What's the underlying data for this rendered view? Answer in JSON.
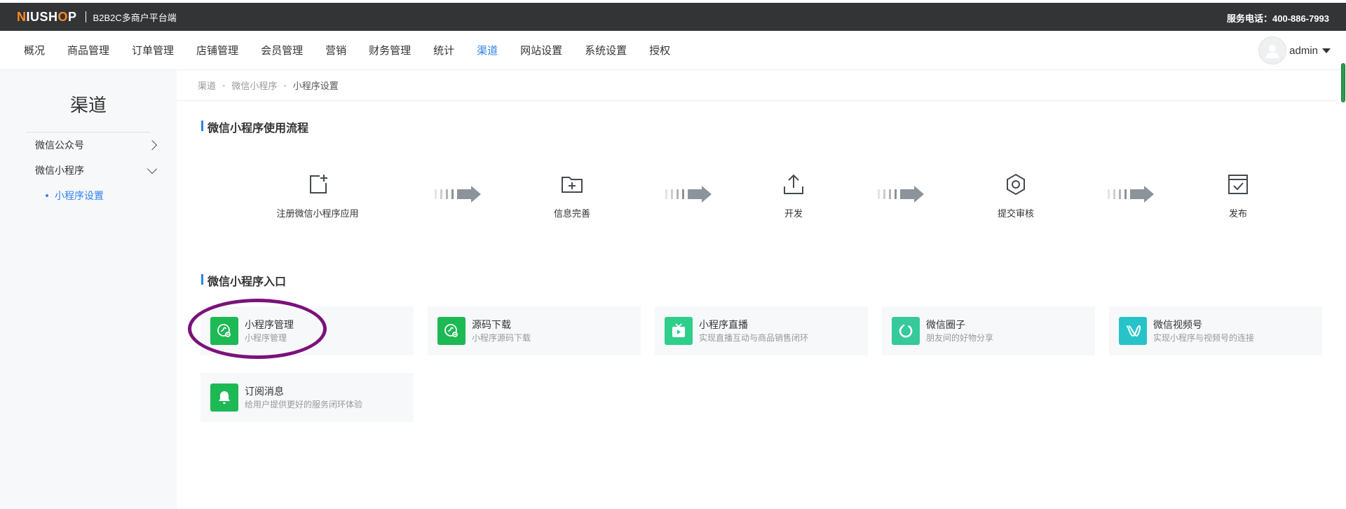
{
  "header": {
    "logo": {
      "n": "N",
      "iush": "IUSH",
      "o": "O",
      "p": "P"
    },
    "subtitle": "B2B2C多商户平台端",
    "hotline": "服务电话：400-886-7993"
  },
  "nav": {
    "items": [
      {
        "label": "概况"
      },
      {
        "label": "商品管理"
      },
      {
        "label": "订单管理"
      },
      {
        "label": "店铺管理"
      },
      {
        "label": "会员管理"
      },
      {
        "label": "营销"
      },
      {
        "label": "财务管理"
      },
      {
        "label": "统计"
      },
      {
        "label": "渠道",
        "active": true
      },
      {
        "label": "网站设置"
      },
      {
        "label": "系统设置"
      },
      {
        "label": "授权"
      }
    ],
    "username": "admin"
  },
  "sidebar": {
    "title": "渠道",
    "items": [
      {
        "label": "微信公众号"
      },
      {
        "label": "微信小程序"
      }
    ],
    "sub_active": "小程序设置"
  },
  "breadcrumb": {
    "items": [
      "渠道",
      "微信小程序",
      "小程序设置"
    ],
    "sep": "-"
  },
  "flow_section": {
    "title": "微信小程序使用流程",
    "steps": [
      {
        "label": "注册微信小程序应用",
        "icon": "register-icon"
      },
      {
        "label": "信息完善",
        "icon": "folder-add-icon"
      },
      {
        "label": "开发",
        "icon": "upload-icon"
      },
      {
        "label": "提交审核",
        "icon": "gear-icon"
      },
      {
        "label": "发布",
        "icon": "publish-icon"
      }
    ]
  },
  "entry_section": {
    "title": "微信小程序入口",
    "cards": [
      {
        "title": "小程序管理",
        "desc": "小程序管理",
        "color": "#1db954",
        "icon": "miniprogram-gear-icon"
      },
      {
        "title": "源码下载",
        "desc": "小程序源码下载",
        "color": "#1db954",
        "icon": "miniprogram-gear-icon"
      },
      {
        "title": "小程序直播",
        "desc": "实现直播互动与商品销售闭环",
        "color": "#2ecf8a",
        "icon": "live-tv-icon"
      },
      {
        "title": "微信圈子",
        "desc": "朋友间的好物分享",
        "color": "#35c99c",
        "icon": "circle-icon"
      },
      {
        "title": "微信视频号",
        "desc": "实现小程序与视频号的连接",
        "color": "#26c4c9",
        "icon": "channels-icon"
      },
      {
        "title": "订阅消息",
        "desc": "给用户提供更好的服务闭环体验",
        "color": "#1db954",
        "icon": "bell-icon"
      }
    ]
  },
  "colors": {
    "accent": "#2f80ed",
    "topbar": "#333436",
    "highlight": "#7b127b"
  }
}
